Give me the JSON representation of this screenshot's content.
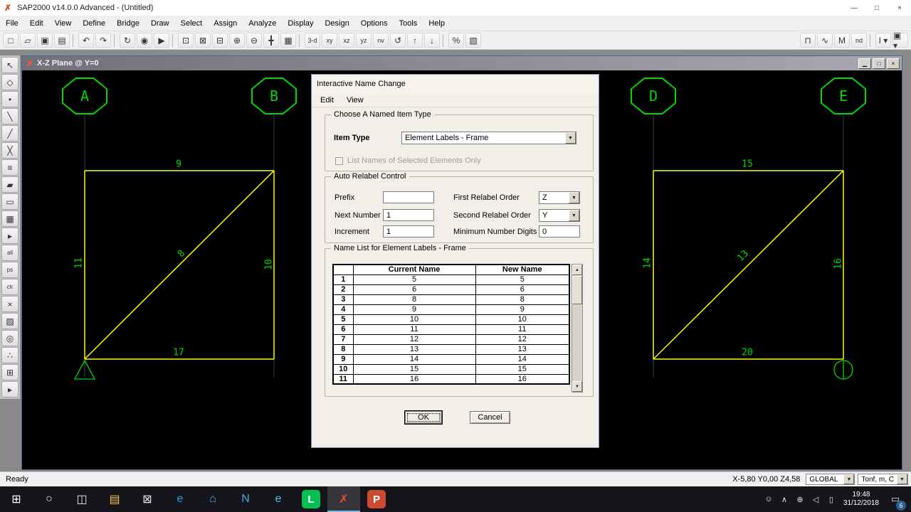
{
  "app": {
    "title": "SAP2000 v14.0.0 Advanced - (Untitled)",
    "icon_glyph": "✗",
    "window_controls": {
      "minimize": "—",
      "maximize": "□",
      "close": "×"
    }
  },
  "icons": {
    "dropdown_arrow": "▼",
    "scroll_up_arrow": "▲",
    "scroll_down_arrow": "▼",
    "action_center": "▭"
  },
  "menu": {
    "items": [
      "File",
      "Edit",
      "View",
      "Define",
      "Bridge",
      "Draw",
      "Select",
      "Assign",
      "Analyze",
      "Display",
      "Design",
      "Options",
      "Tools",
      "Help"
    ]
  },
  "toolbar": {
    "items": [
      {
        "name": "new-model-button",
        "glyph": "□"
      },
      {
        "name": "open-file-button",
        "glyph": "▱"
      },
      {
        "name": "save-model-button",
        "glyph": "▣"
      },
      {
        "name": "print-button",
        "glyph": "▤"
      },
      {
        "type": "sep",
        "name": "toolbar-separator"
      },
      {
        "name": "undo-button",
        "glyph": "↶"
      },
      {
        "name": "redo-button",
        "glyph": "↷"
      },
      {
        "type": "sep",
        "name": "toolbar-separator"
      },
      {
        "name": "refresh-window-button",
        "glyph": "↻"
      },
      {
        "name": "lock-model-button",
        "glyph": "◉"
      },
      {
        "name": "run-analysis-button",
        "glyph": "▶"
      },
      {
        "type": "sep",
        "name": "toolbar-separator"
      },
      {
        "name": "rubber-band-zoom-button",
        "glyph": "⊡"
      },
      {
        "name": "restore-full-view-button",
        "glyph": "⊠"
      },
      {
        "name": "previous-zoom-button",
        "glyph": "⊟"
      },
      {
        "name": "zoom-in-button",
        "glyph": "⊕"
      },
      {
        "name": "zoom-out-button",
        "glyph": "⊖"
      },
      {
        "name": "pan-button",
        "glyph": "╋"
      },
      {
        "name": "set-view-limits-button",
        "glyph": "▦"
      },
      {
        "type": "sep",
        "name": "toolbar-separator"
      },
      {
        "name": "default-3d-view-button",
        "glyph": "3-d",
        "text": true
      },
      {
        "name": "xy-view-button",
        "glyph": "xy",
        "text": true
      },
      {
        "name": "xz-view-button",
        "glyph": "xz",
        "text": true
      },
      {
        "name": "yz-view-button",
        "glyph": "yz",
        "text": true
      },
      {
        "name": "named-view-button",
        "glyph": "nv",
        "text": true
      },
      {
        "name": "perspective-toggle-button",
        "glyph": "↺"
      },
      {
        "name": "up-one-gridline-button",
        "glyph": "↑"
      },
      {
        "name": "down-one-gridline-button",
        "glyph": "↓"
      },
      {
        "type": "sep",
        "name": "toolbar-separator"
      },
      {
        "name": "object-shrink-toggle-button",
        "glyph": "%"
      },
      {
        "name": "set-display-options-button",
        "glyph": "▧"
      },
      {
        "type": "spacer",
        "name": "toolbar-spacer"
      },
      {
        "name": "show-undeformed-shape-button",
        "glyph": "⊓"
      },
      {
        "name": "show-deformed-shape-button",
        "glyph": "∿"
      },
      {
        "name": "show-forces-stresses-button",
        "glyph": "M"
      },
      {
        "name": "show-named-display-button",
        "glyph": "nd",
        "text": true
      },
      {
        "type": "sep",
        "name": "toolbar-separator"
      },
      {
        "name": "assign-frame-sections-dropdown",
        "glyph": "I ▾"
      },
      {
        "name": "display-templates-dropdown",
        "glyph": "▣ ▾"
      }
    ]
  },
  "left_toolbar": {
    "items": [
      {
        "name": "select-pointer-button",
        "glyph": "↖"
      },
      {
        "name": "reshape-element-button",
        "glyph": "◇"
      },
      {
        "name": "draw-special-joint-button",
        "glyph": "•"
      },
      {
        "name": "draw-frame-button",
        "glyph": "╲"
      },
      {
        "name": "quick-draw-frame-button",
        "glyph": "╱"
      },
      {
        "name": "quick-draw-braces-button",
        "glyph": "╳"
      },
      {
        "name": "quick-draw-secondary-beams-button",
        "glyph": "≡"
      },
      {
        "name": "draw-poly-area-button",
        "glyph": "▰"
      },
      {
        "name": "draw-rectangular-area-button",
        "glyph": "▭"
      },
      {
        "name": "quick-draw-area-button",
        "glyph": "▦"
      },
      {
        "name": "draw-flyout-button",
        "glyph": "▸"
      },
      {
        "name": "select-all-button",
        "glyph": "all",
        "text": true
      },
      {
        "name": "previous-selection-button",
        "glyph": "ps",
        "text": true
      },
      {
        "name": "clear-selection-button",
        "glyph": "clr",
        "text": true
      },
      {
        "name": "intersecting-line-select-button",
        "glyph": "×"
      },
      {
        "name": "poly-select-button",
        "glyph": "▨"
      },
      {
        "name": "snap-to-points-button",
        "glyph": "◎"
      },
      {
        "name": "snap-to-intersections-button",
        "glyph": "∴"
      },
      {
        "name": "show-grid-button",
        "glyph": "⊞"
      },
      {
        "name": "select-flyout-button",
        "glyph": "▸"
      }
    ]
  },
  "child_window": {
    "title": "X-Z Plane @ Y=0",
    "controls": {
      "minimize": "▁",
      "restore": "□",
      "close": "×"
    }
  },
  "model": {
    "grid_bubbles": [
      {
        "label": "A"
      },
      {
        "label": "B"
      },
      {
        "label": "D"
      },
      {
        "label": "E"
      }
    ],
    "member_labels": [
      {
        "text": "9"
      },
      {
        "text": "15"
      },
      {
        "text": "11"
      },
      {
        "text": "8"
      },
      {
        "text": "10"
      },
      {
        "text": "14"
      },
      {
        "text": "13"
      },
      {
        "text": "16"
      },
      {
        "text": "17"
      },
      {
        "text": "20"
      }
    ],
    "colors": {
      "frame": "#f8fc00",
      "label": "#00d800",
      "grid": "#31493b"
    }
  },
  "dialog": {
    "title": "Interactive Name Change",
    "menu": {
      "items": [
        "Edit",
        "View"
      ]
    },
    "item_type_group": {
      "caption": "Choose A Named Item Type",
      "item_type_label": "Item Type",
      "item_type_value": "Element Labels - Frame",
      "checkbox_label": "List Names of Selected Elements Only"
    },
    "relabel_group": {
      "caption": "Auto Relabel Control",
      "prefix_label": "Prefix",
      "prefix_value": "",
      "next_number_label": "Next Number",
      "next_number_value": "1",
      "increment_label": "Increment",
      "increment_value": "1",
      "first_order_label": "First Relabel Order",
      "first_order_value": "Z",
      "second_order_label": "Second Relabel Order",
      "second_order_value": "Y",
      "min_digits_label": "Minimum Number Digits",
      "min_digits_value": "0"
    },
    "name_list_group": {
      "caption": "Name List for Element Labels - Frame",
      "columns": [
        "Current Name",
        "New Name"
      ],
      "rows": [
        {
          "num": "1",
          "current": "5",
          "new_name": "5"
        },
        {
          "num": "2",
          "current": "6",
          "new_name": "6"
        },
        {
          "num": "3",
          "current": "8",
          "new_name": "8"
        },
        {
          "num": "4",
          "current": "9",
          "new_name": "9"
        },
        {
          "num": "5",
          "current": "10",
          "new_name": "10"
        },
        {
          "num": "6",
          "current": "11",
          "new_name": "11"
        },
        {
          "num": "7",
          "current": "12",
          "new_name": "12"
        },
        {
          "num": "8",
          "current": "13",
          "new_name": "13"
        },
        {
          "num": "9",
          "current": "14",
          "new_name": "14"
        },
        {
          "num": "10",
          "current": "15",
          "new_name": "15"
        },
        {
          "num": "11",
          "current": "16",
          "new_name": "16"
        }
      ]
    },
    "ok_label": "OK",
    "cancel_label": "Cancel"
  },
  "status_bar": {
    "ready": "Ready",
    "coords": "X-5,80  Y0,00  Z4,58",
    "csys": "GLOBAL",
    "units": "Tonf, m, C"
  },
  "taskbar": {
    "items": [
      {
        "name": "start-button",
        "glyph": "⊞",
        "color": "#ffffff"
      },
      {
        "name": "search-button",
        "glyph": "○",
        "color": "#e8e8e8"
      },
      {
        "name": "task-view-button",
        "glyph": "◫",
        "color": "#e8e8e8"
      },
      {
        "name": "file-explorer-button",
        "glyph": "▤",
        "color": "#e8c84a"
      },
      {
        "name": "mail-button",
        "glyph": "⊠",
        "color": "#e8e8e8"
      },
      {
        "name": "edge-button",
        "glyph": "e",
        "color": "#2f9ae0"
      },
      {
        "name": "store-button",
        "glyph": "⌂",
        "color": "#58b0e8"
      },
      {
        "name": "nox-player-button",
        "glyph": "N",
        "color": "#48a8e0"
      },
      {
        "name": "internet-explorer-button",
        "glyph": "e",
        "color": "#55b8ea"
      },
      {
        "name": "line-button",
        "glyph": "L",
        "bg": "#06c152",
        "color": "#ffffff"
      },
      {
        "name": "sap2000-button",
        "glyph": "✗",
        "color": "#e8512a",
        "active": true
      },
      {
        "name": "powerpoint-button",
        "glyph": "P",
        "bg": "#cb4a32",
        "color": "#ffffff"
      }
    ],
    "tray": {
      "icons": [
        {
          "name": "people-icon",
          "glyph": "☺"
        },
        {
          "name": "hidden-icons-chevron",
          "glyph": "∧"
        },
        {
          "name": "network-icon",
          "glyph": "⊕"
        },
        {
          "name": "volume-icon",
          "glyph": "◁"
        },
        {
          "name": "battery-icon",
          "glyph": "▯"
        }
      ],
      "time": "19:48",
      "date": "31/12/2018",
      "notification_badge": "6"
    }
  }
}
